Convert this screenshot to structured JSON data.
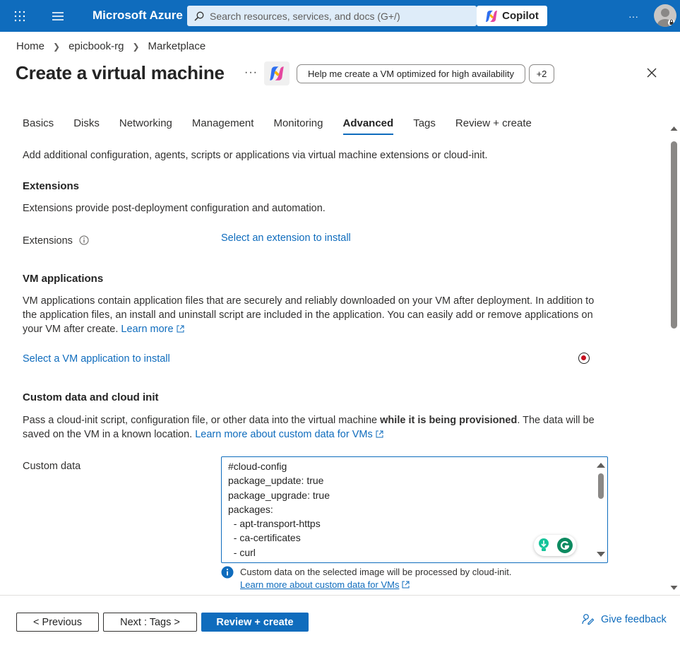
{
  "topbar": {
    "brand": "Microsoft Azure",
    "search_placeholder": "Search resources, services, and docs (G+/)",
    "copilot_label": "Copilot",
    "more_label": "···",
    "accent_color": "#0f6cbd"
  },
  "breadcrumb": [
    "Home",
    "epicbook-rg",
    "Marketplace"
  ],
  "page": {
    "title": "Create a virtual machine",
    "more_label": "···",
    "suggestion": "Help me create a VM optimized for high availability",
    "extra_count": "+2"
  },
  "tabs": [
    "Basics",
    "Disks",
    "Networking",
    "Management",
    "Monitoring",
    "Advanced",
    "Tags",
    "Review + create"
  ],
  "active_tab": "Advanced",
  "intro": "Add additional configuration, agents, scripts or applications via virtual machine extensions or cloud-init.",
  "extensions": {
    "heading": "Extensions",
    "desc": "Extensions provide post-deployment configuration and automation.",
    "label": "Extensions",
    "link": "Select an extension to install"
  },
  "vm_applications": {
    "heading": "VM applications",
    "desc_line1": "VM applications contain application files that are securely and reliably downloaded on your VM after deployment. In addition to",
    "desc_line2": "the application files, an install and uninstall script are included in the application. You can easily add or remove applications on",
    "desc_line3": "your VM after create.",
    "learn_more": "Learn more",
    "link": "Select a VM application to install"
  },
  "custom_data": {
    "heading": "Custom data and cloud init",
    "desc_part1": "Pass a cloud-init script, configuration file, or other data into the virtual machine",
    "desc_bold": "while it is being provisioned",
    "desc_part2": ". The data will be",
    "desc_line2": "saved on the VM in a known location.",
    "learn_more": "Learn more about custom data for VMs",
    "label": "Custom data",
    "value_lines": [
      "#cloud-config",
      "package_update: true",
      "package_upgrade: true",
      "packages:",
      "  - apt-transport-https",
      "  - ca-certificates",
      "  - curl"
    ],
    "info_text": "Custom data on the selected image will be processed by cloud-init.",
    "info_link": "Learn more about custom data for VMs"
  },
  "footer": {
    "previous": "< Previous",
    "next": "Next : Tags >",
    "review": "Review + create",
    "feedback": "Give feedback"
  }
}
